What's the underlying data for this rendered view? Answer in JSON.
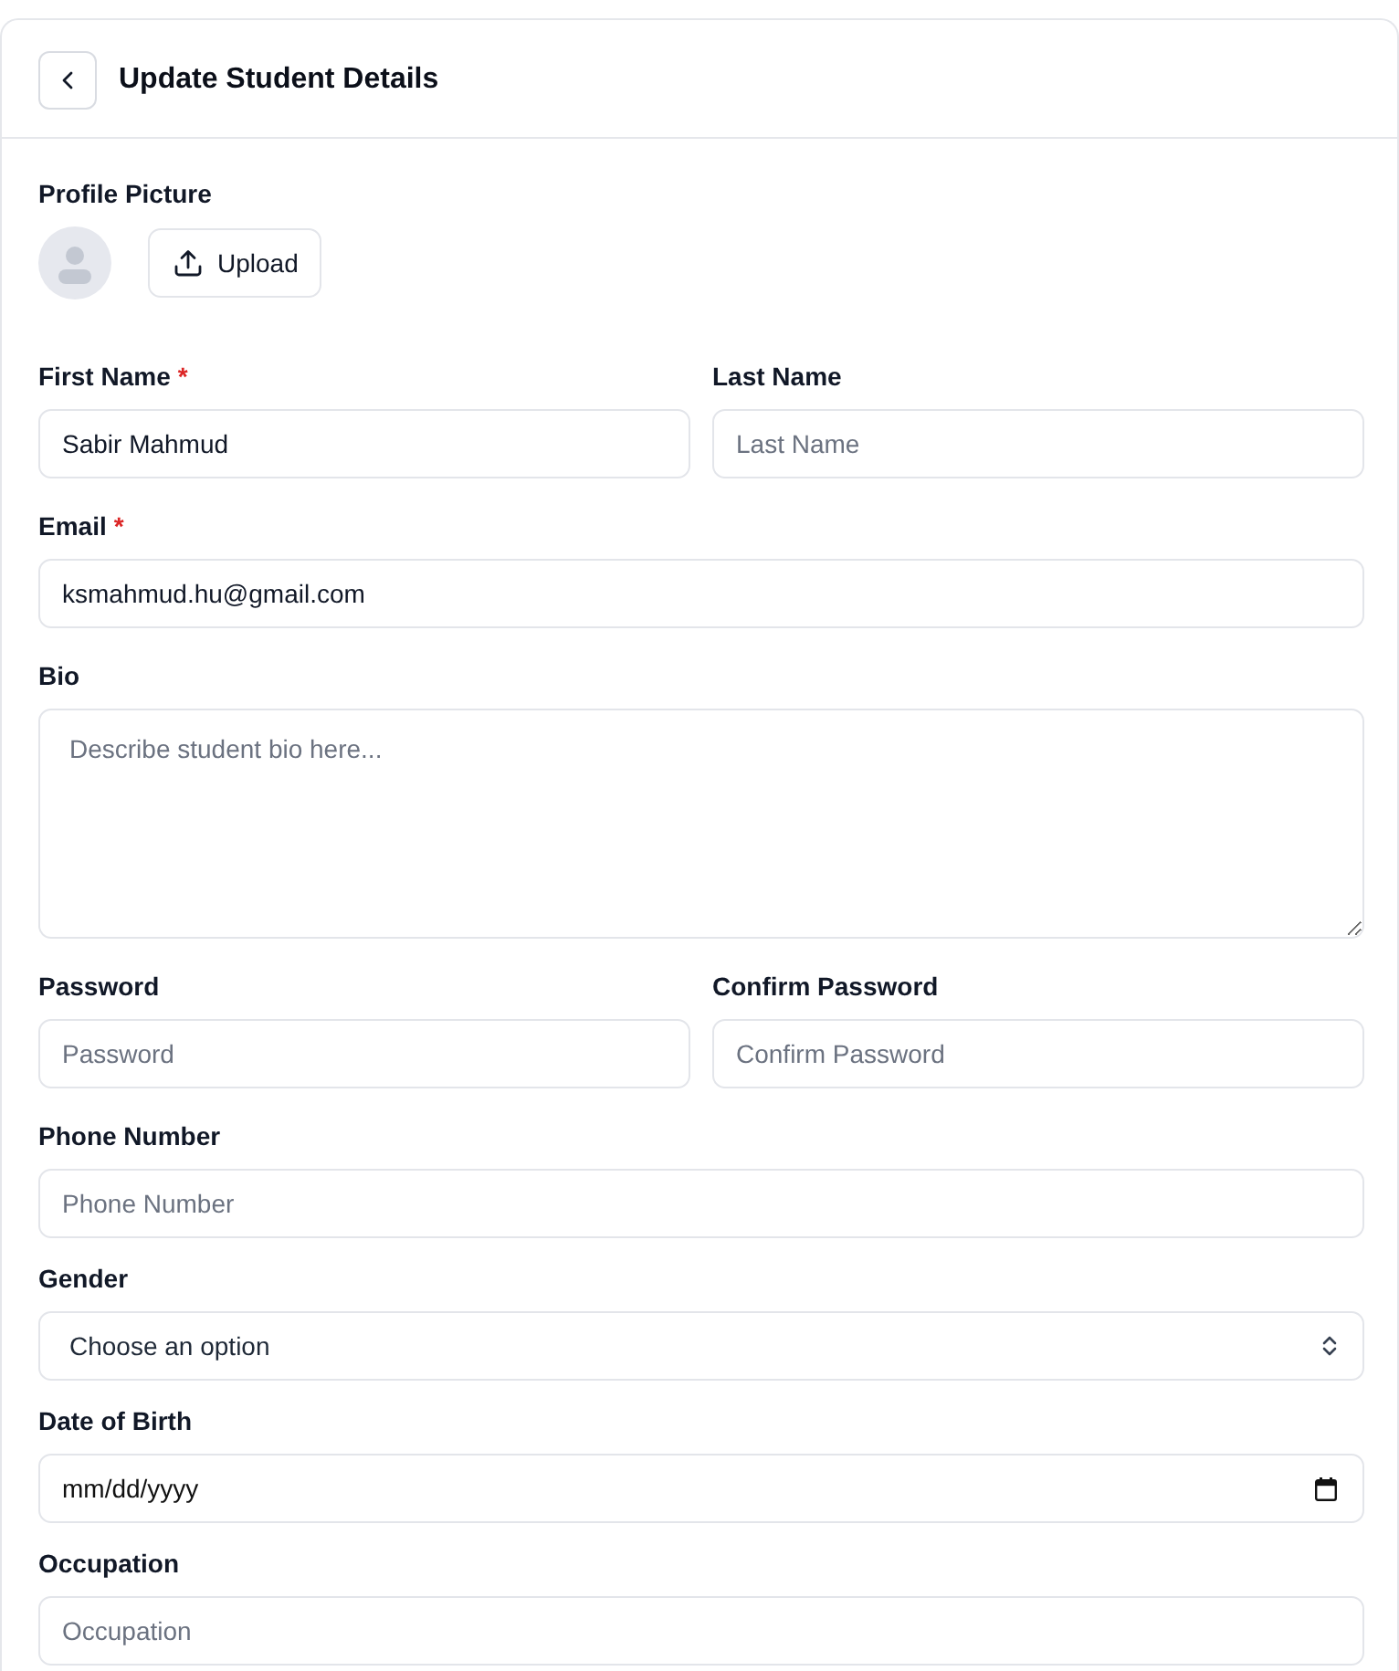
{
  "header": {
    "title": "Update Student Details"
  },
  "profile_picture": {
    "label": "Profile Picture",
    "upload_button": "Upload"
  },
  "form_rows": [
    {
      "fields": [
        {
          "kind": "text",
          "label": "First Name",
          "asterisk": "*",
          "value": "Sabir Mahmud"
        },
        {
          "kind": "text",
          "label": "Last Name",
          "placeholder": "Last Name"
        }
      ]
    },
    {
      "fields": [
        {
          "kind": "text",
          "label": "Email",
          "asterisk": "*",
          "value": "ksmahmud.hu@gmail.com"
        }
      ]
    },
    {
      "fields": [
        {
          "kind": "textarea",
          "label": "Bio",
          "placeholder": "Describe student bio here..."
        }
      ]
    },
    {
      "fields": [
        {
          "kind": "password",
          "label": "Password",
          "placeholder": "Password"
        },
        {
          "kind": "password",
          "label": "Confirm Password",
          "placeholder": "Confirm Password"
        }
      ]
    },
    {
      "fields": [
        {
          "kind": "text",
          "label": "Phone Number",
          "placeholder": "Phone Number"
        }
      ]
    },
    {
      "fields": [
        {
          "kind": "select",
          "label": "Gender",
          "value": "Choose an option"
        }
      ]
    },
    {
      "fields": [
        {
          "kind": "date",
          "label": "Date of Birth",
          "placeholder": "mm/dd/yyyy"
        }
      ]
    },
    {
      "fields": [
        {
          "kind": "text",
          "label": "Occupation",
          "placeholder": "Occupation"
        }
      ]
    }
  ]
}
